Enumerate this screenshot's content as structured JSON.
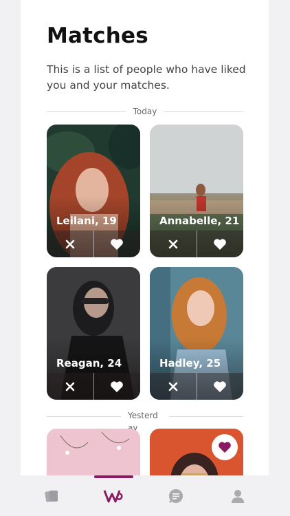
{
  "header": {
    "title": "Matches",
    "subtitle": "This is a list of people who have liked you and your matches."
  },
  "sections": [
    {
      "label": "Today"
    },
    {
      "label": "Yesterday"
    }
  ],
  "cards": [
    {
      "name": "Leilani, 19"
    },
    {
      "name": "Annabelle, 21"
    },
    {
      "name": "Reagan, 24"
    },
    {
      "name": "Hadley, 25"
    }
  ],
  "tabbar": {
    "active": "matches",
    "items": [
      "cards-icon",
      "matches-logo",
      "chat-icon",
      "profile-icon"
    ]
  },
  "colors": {
    "accent": "#8a1a62",
    "inactive_icon": "#a9a9ae"
  }
}
